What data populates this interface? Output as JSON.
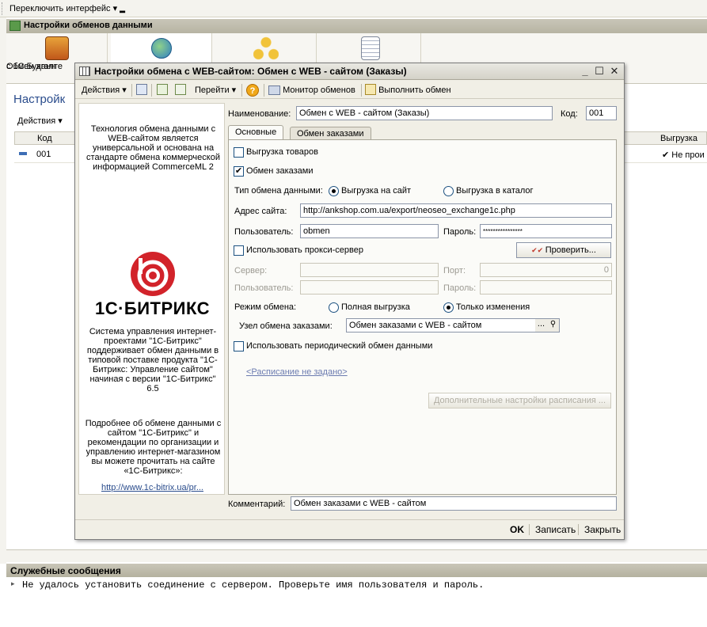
{
  "topbar": {
    "menu_label": "Переключить интерфейс"
  },
  "bgwin": {
    "title": "Настройки обменов данными",
    "tabs": [
      {
        "label_line1": "Обмен данн",
        "label_line2": "с 1С:Бухгалте"
      },
      {
        "label_line1": "",
        "label_line2": ""
      },
      {
        "label_line1": "",
        "label_line2": ""
      },
      {
        "label_line1": "",
        "label_line2": ""
      }
    ],
    "heading": "Настройк",
    "actions_label": "Действия",
    "table": {
      "columns": [
        "Код",
        "Выгрузка"
      ],
      "rows": [
        {
          "code": "001",
          "export": "Не прои"
        }
      ]
    }
  },
  "messages": {
    "title": "Служебные сообщения",
    "text": "Не удалось установить соединение с сервером. Проверьте имя пользователя и пароль."
  },
  "dialog": {
    "title": "Настройки обмена с WEB-сайтом: Обмен с WEB - сайтом (Заказы)",
    "window_buttons": {
      "minimize": "_",
      "maximize": "☐",
      "close": "✕"
    },
    "toolbar": {
      "actions": "Действия",
      "goto": "Перейти",
      "help": "?",
      "monitor": "Монитор обменов",
      "run": "Выполнить обмен"
    },
    "info": {
      "p1": "Технология обмена данными с WEB-сайтом является универсальной и основана на стандарте обмена коммерческой информацией CommerceML 2",
      "logo_text": "1С·БИТРИКС",
      "p2": "Система управления интернет-проектами \"1С-Битрикс\" поддерживает обмен данными в типовой поставке продукта \"1С-Битрикс: Управление сайтом\" начиная с версии \"1С-Битрикс\" 6.5",
      "p3": "Подробнее об обмене данными с сайтом \"1С-Битрикс\" и рекомендации по организации и управлению интернет-магазином вы можете прочитать на сайте «1С-Битрикс»:",
      "link": "http://www.1c-bitrix.ua/pr..."
    },
    "form": {
      "name_label": "Наименование:",
      "name_value": "Обмен с WEB - сайтом (Заказы)",
      "code_label": "Код:",
      "code_value": "001",
      "tabs": [
        "Основные",
        "Обмен заказами"
      ],
      "export_goods_label": "Выгрузка товаров",
      "export_goods_checked": false,
      "order_exchange_label": "Обмен заказами",
      "order_exchange_checked": true,
      "exchange_type_label": "Тип обмена данными:",
      "exchange_type_options": [
        "Выгрузка на сайт",
        "Выгрузка в каталог"
      ],
      "exchange_type_selected": 0,
      "site_label": "Адрес сайта:",
      "site_value": "http://ankshop.com.ua/export/neoseo_exchange1c.php",
      "user_label": "Пользователь:",
      "user_value": "obmen",
      "password_label": "Пароль:",
      "password_value": "****************",
      "proxy_label": "Использовать прокси-сервер",
      "proxy_checked": false,
      "check_button": "Проверить...",
      "server_label": "Сервер:",
      "port_label": "Порт:",
      "port_value": "0",
      "proxy_user_label": "Пользователь:",
      "proxy_password_label": "Пароль:",
      "mode_label": "Режим обмена:",
      "mode_options": [
        "Полная выгрузка",
        "Только изменения"
      ],
      "mode_selected": 1,
      "node_label": "Узел обмена заказами:",
      "node_value": "Обмен заказами с WEB - сайтом",
      "node_select": "...",
      "periodic_label": "Использовать периодический обмен данными",
      "periodic_checked": false,
      "schedule_link": "<Расписание не задано>",
      "schedule_button": "Дополнительные настройки расписания ...",
      "comment_label": "Комментарий:",
      "comment_value": "Обмен заказами с WEB - сайтом"
    },
    "footer": {
      "ok": "OK",
      "save": "Записать",
      "close": "Закрыть"
    }
  }
}
